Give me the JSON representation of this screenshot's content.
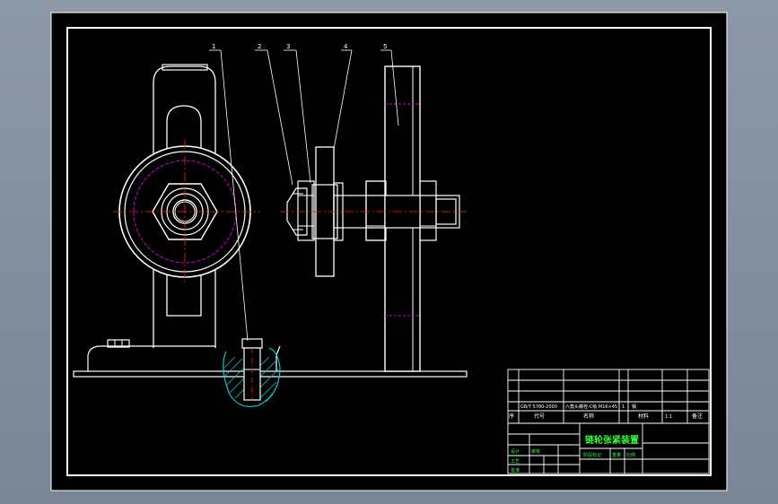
{
  "part_labels": [
    "1",
    "2",
    "3",
    "4",
    "5"
  ],
  "title_block": {
    "drawing_title": "链轮张紧装置",
    "header_cols": [
      "序",
      "代号",
      "名称",
      "",
      "材料",
      "",
      "备注"
    ],
    "row_code": "GB/T 5780-2000",
    "row_name": "六角头螺栓-C级 M16×45",
    "row_qty": "1",
    "row_material": "钢",
    "green_small_1": "设计",
    "green_small_2": "审核",
    "green_small_3": "工艺",
    "green_small_4": "批准",
    "green_labels_mid": "阶段标记",
    "green_weight": "重量",
    "green_scale": "比例",
    "scale_value": "1:1"
  },
  "colors": {
    "background": "#000000",
    "line": "#ffffff",
    "center_line": "#ff2020",
    "hidden_circle": "#d000d0",
    "hatch": "#00d8d8",
    "title_green": "#33ff33"
  }
}
